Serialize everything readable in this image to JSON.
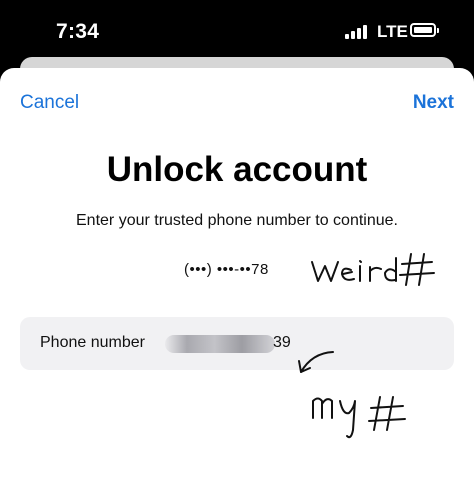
{
  "status_bar": {
    "time": "7:34",
    "network": "LTE",
    "icons": [
      "signal-icon",
      "battery-icon"
    ]
  },
  "nav": {
    "cancel_label": "Cancel",
    "next_label": "Next"
  },
  "main": {
    "title": "Unlock account",
    "subtitle": "Enter your trusted phone number to continue.",
    "masked_phone": "(•••) •••-••78",
    "phone_field": {
      "label": "Phone number",
      "value_suffix": "39"
    }
  },
  "handwritten_annotations": {
    "note_masked": "weird #",
    "note_field": "my #"
  },
  "colors": {
    "accent": "#1b73d9",
    "field_background": "#f1f1f3",
    "status_bar_background": "#000000"
  }
}
